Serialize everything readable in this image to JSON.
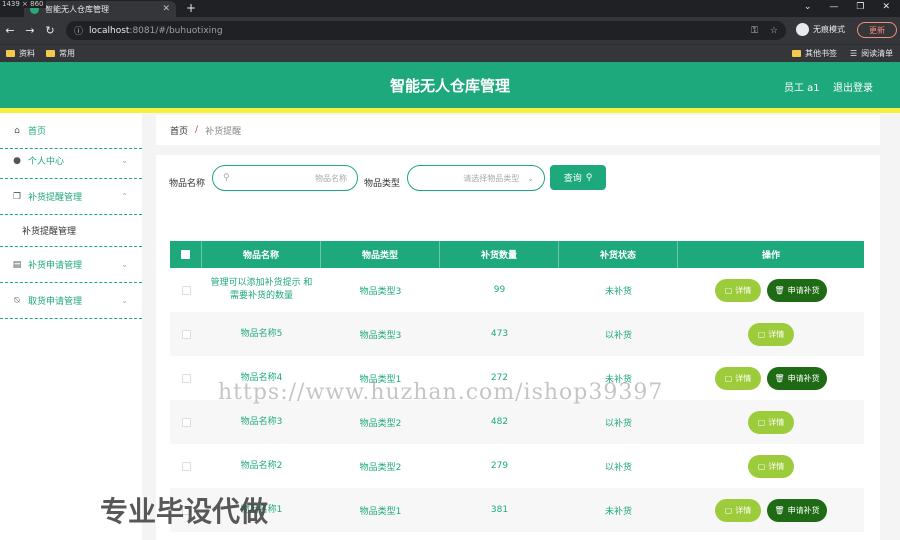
{
  "browser": {
    "dimensions_tag": "1439 × 860",
    "tab_title": "智能无人仓库管理",
    "url_host": "localhost",
    "url_rest": ":8081/#/buhuotixing",
    "profile_label": "无痕模式",
    "update_label": "更新",
    "bookmarks": [
      "资料",
      "常用"
    ],
    "bookmark_right": [
      "其他书签",
      "阅读清单"
    ]
  },
  "header": {
    "title": "智能无人仓库管理",
    "user": "员工 a1",
    "logout": "退出登录"
  },
  "sidebar": {
    "items": [
      {
        "label": "首页"
      },
      {
        "label": "个人中心"
      },
      {
        "label": "补货提醒管理"
      },
      {
        "label": "补货提醒管理",
        "sub": true
      },
      {
        "label": "补货申请管理"
      },
      {
        "label": "取货申请管理"
      }
    ]
  },
  "breadcrumb": {
    "home": "首页",
    "sep": "/",
    "current": "补货提醒"
  },
  "filters": {
    "name_label": "物品名称",
    "name_placeholder": "物品名称",
    "type_label": "物品类型",
    "type_placeholder": "请选择物品类型",
    "query_button": "查询"
  },
  "table": {
    "headers": [
      "物品名称",
      "物品类型",
      "补货数量",
      "补货状态",
      "操作"
    ],
    "detail_label": "详情",
    "apply_label": "申请补货",
    "rows": [
      {
        "name": "管理可以添加补货提示 和需要补货的数量",
        "type": "物品类型3",
        "qty": "99",
        "status": "未补货",
        "apply": true
      },
      {
        "name": "物品名称5",
        "type": "物品类型3",
        "qty": "473",
        "status": "以补货",
        "apply": false
      },
      {
        "name": "物品名称4",
        "type": "物品类型1",
        "qty": "272",
        "status": "未补货",
        "apply": true
      },
      {
        "name": "物品名称3",
        "type": "物品类型2",
        "qty": "482",
        "status": "以补货",
        "apply": false
      },
      {
        "name": "物品名称2",
        "type": "物品类型2",
        "qty": "279",
        "status": "以补货",
        "apply": false
      },
      {
        "name": "物品名称1",
        "type": "物品类型1",
        "qty": "381",
        "status": "未补货",
        "apply": true
      }
    ]
  },
  "overlay": {
    "watermark": "https://www.huzhan.com/ishop39397",
    "badge": "专业毕设代做"
  },
  "colors": {
    "brand": "#1ea97c",
    "accent_yellow": "#f5f03c",
    "detail_btn": "#9ccc3c",
    "apply_btn": "#1f6a14"
  }
}
